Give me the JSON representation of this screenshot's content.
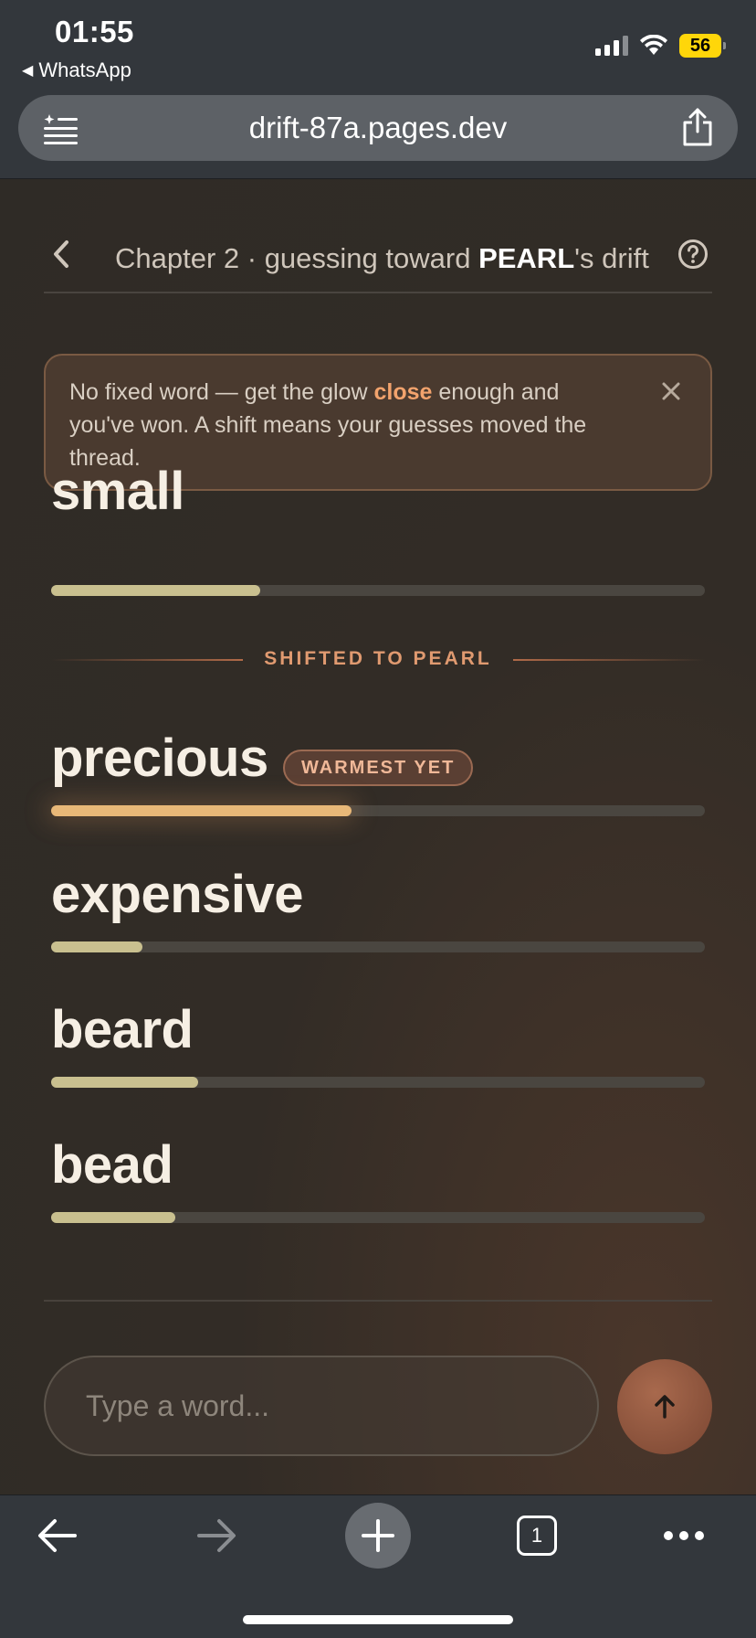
{
  "status_bar": {
    "time": "01:55",
    "back_app": "WhatsApp",
    "battery": "56",
    "icons": [
      "signal-icon",
      "wifi-icon",
      "battery-icon"
    ]
  },
  "browser": {
    "url": "drift-87a.pages.dev",
    "tab_count": "1"
  },
  "header": {
    "chapter_prefix": "Chapter 2 · guessing toward ",
    "target_word": "PEARL",
    "chapter_suffix": "'s drift"
  },
  "notice": {
    "text_before": "No fixed word — get the glow ",
    "highlight": "close",
    "text_after": " enough and you've won. A shift means your guesses moved the thread."
  },
  "guesses": [
    {
      "word": "small",
      "warmth": 0.32
    },
    {
      "word": "precious",
      "warmth": 0.46,
      "badge": "WARMEST YET"
    },
    {
      "word": "expensive",
      "warmth": 0.14
    },
    {
      "word": "beard",
      "warmth": 0.225
    },
    {
      "word": "bead",
      "warmth": 0.19
    }
  ],
  "shift_label": "SHIFTED TO PEARL",
  "input": {
    "placeholder": "Type a word..."
  },
  "colors": {
    "accent": "#f2a36d",
    "warm_fill": "#e8b878",
    "fill": "#c9c08f",
    "track": "#4a4640",
    "submit": "#8f553d"
  }
}
